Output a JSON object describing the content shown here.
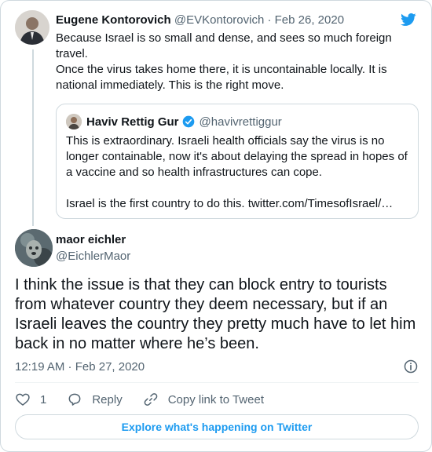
{
  "parent": {
    "name": "Eugene Kontorovich",
    "meta": "@EVKontorovich · Feb 26, 2020",
    "lines": [
      "Because Israel is so small and dense, and sees so much foreign travel.",
      "Once the virus takes home there, it is uncontainable locally. It is national immediately. This is the right move."
    ]
  },
  "quote": {
    "name": "Haviv Rettig Gur",
    "handle": "@havivrettiggur",
    "text1": "This is extraordinary. Israeli health officials say the virus is no longer containable, now it's about delaying the spread in hopes of a vaccine and so health infrastructures can cope.",
    "text2": "Israel is the first country to do this. twitter.com/TimesofIsrael/…"
  },
  "main": {
    "name": "maor eichler",
    "handle": "@EichlerMaor",
    "text": "I think the issue is that they can block entry to tourists from whatever country they deem necessary, but if an Israeli leaves the country they pretty much have to let him back in no matter where he’s been.",
    "timestamp": "12:19 AM · Feb 27, 2020"
  },
  "actions": {
    "like_count": "1",
    "reply_label": "Reply",
    "copy_label": "Copy link to Tweet"
  },
  "explore_label": "Explore what's happening on Twitter",
  "colors": {
    "accent": "#1d9bf0",
    "muted": "#536471",
    "border": "#cfd9de"
  },
  "icons": [
    "twitter-bird-icon",
    "verified-badge-icon",
    "info-icon",
    "heart-icon",
    "reply-icon",
    "link-icon"
  ]
}
